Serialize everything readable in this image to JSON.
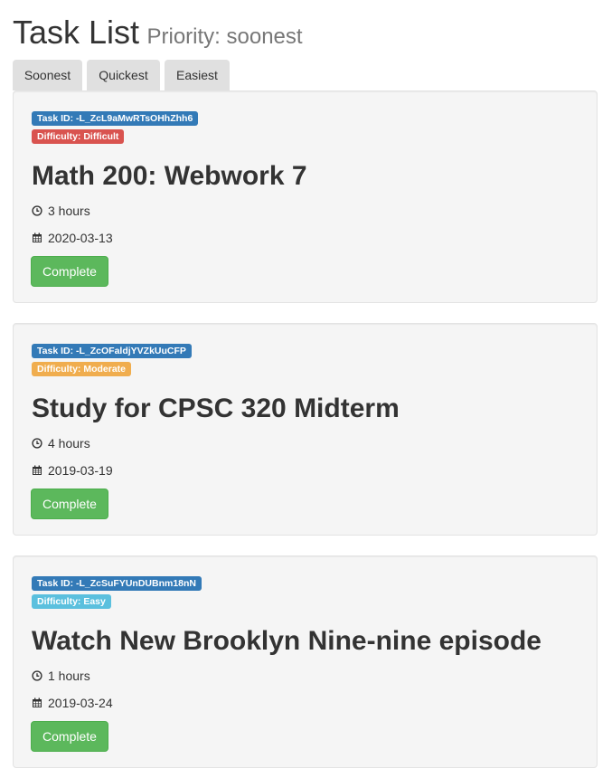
{
  "header": {
    "title": "Task List",
    "subtitle": "Priority: soonest"
  },
  "sort_buttons": [
    "Soonest",
    "Quickest",
    "Easiest"
  ],
  "complete_label": "Complete",
  "tasks": [
    {
      "id_label": "Task ID: -L_ZcL9aMwRTsOHhZhh6",
      "difficulty_label": "Difficulty: Difficult",
      "difficulty_color": "#d9534f",
      "title": "Math 200: Webwork 7",
      "hours": "3 hours",
      "date": "2020-03-13"
    },
    {
      "id_label": "Task ID: -L_ZcOFaldjYVZkUuCFP",
      "difficulty_label": "Difficulty: Moderate",
      "difficulty_color": "#f0ad4e",
      "title": "Study for CPSC 320 Midterm",
      "hours": "4 hours",
      "date": "2019-03-19"
    },
    {
      "id_label": "Task ID: -L_ZcSuFYUnDUBnm18nN",
      "difficulty_label": "Difficulty: Easy",
      "difficulty_color": "#5bc0de",
      "title": "Watch New Brooklyn Nine-nine episode",
      "hours": "1 hours",
      "date": "2019-03-24"
    }
  ],
  "icons": {
    "hours": "clock-icon",
    "date": "calendar-icon"
  }
}
